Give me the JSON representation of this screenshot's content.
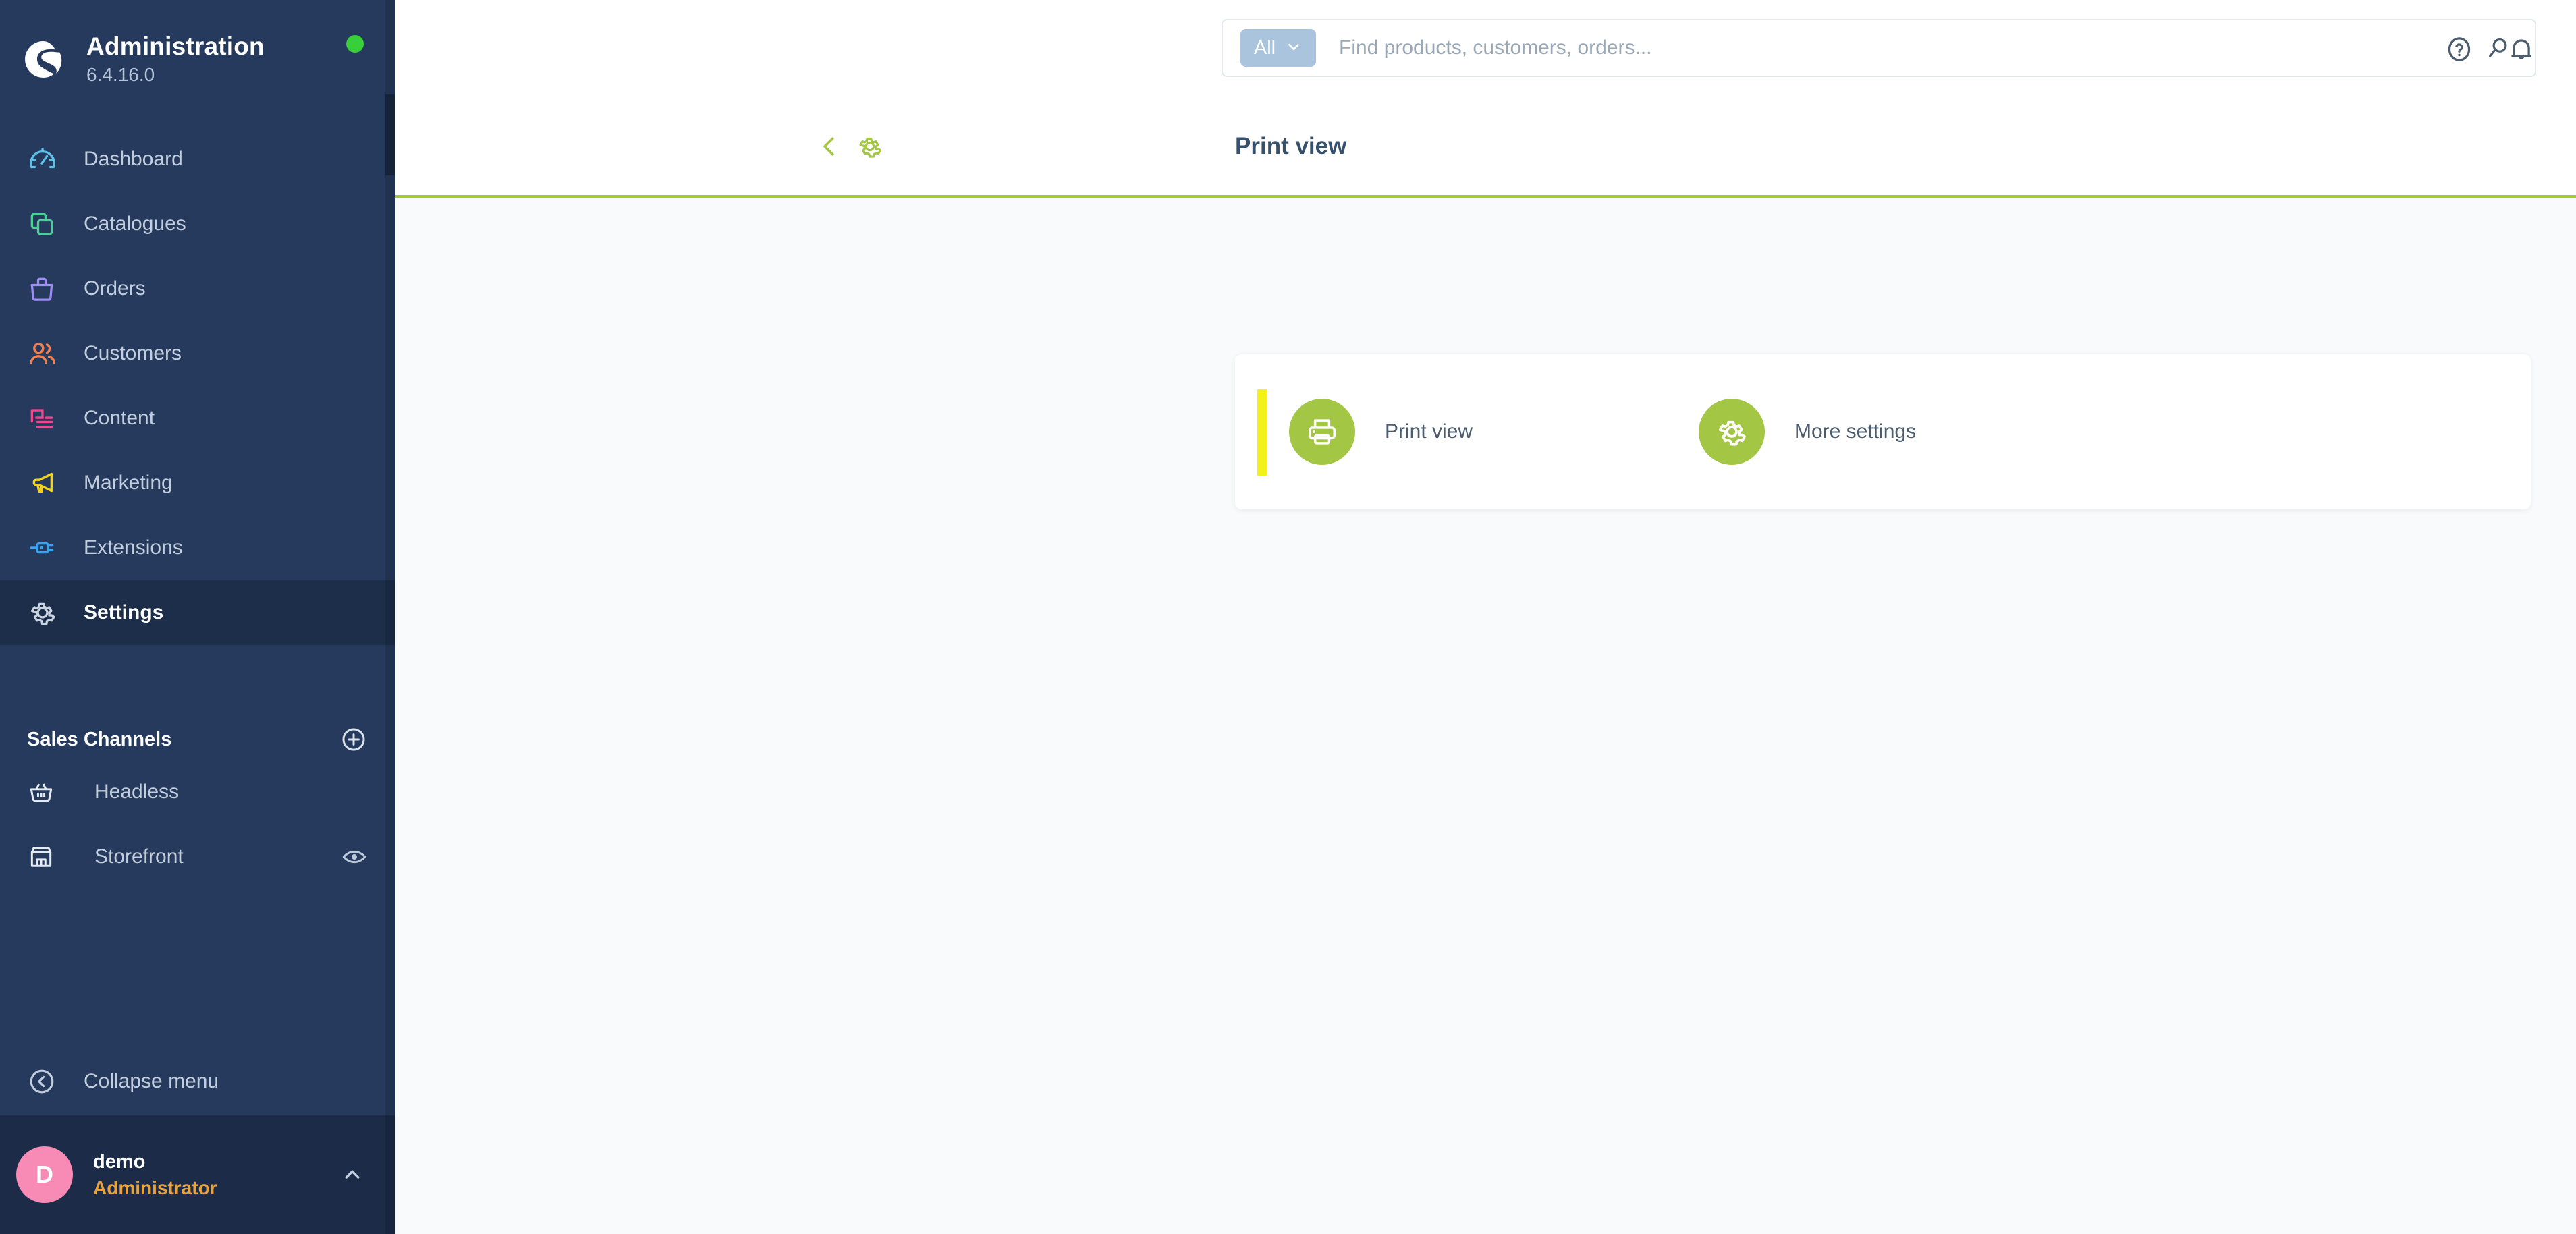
{
  "sidebar": {
    "brand": {
      "title": "Administration",
      "version": "6.4.16.0",
      "status_dot_color": "#37d03b",
      "logo_icon": "shopware-logo-icon"
    },
    "nav_items": [
      {
        "label": "Dashboard",
        "icon": "speedometer-icon",
        "color": "#5ec2e8",
        "active": false
      },
      {
        "label": "Catalogues",
        "icon": "layers-icon",
        "color": "#4ecf9a",
        "active": false
      },
      {
        "label": "Orders",
        "icon": "bag-icon",
        "color": "#9d8cf2",
        "active": false
      },
      {
        "label": "Customers",
        "icon": "users-icon",
        "color": "#ef8153",
        "active": false
      },
      {
        "label": "Content",
        "icon": "content-icon",
        "color": "#f0488f",
        "active": false
      },
      {
        "label": "Marketing",
        "icon": "megaphone-icon",
        "color": "#f2d11f",
        "active": false
      },
      {
        "label": "Extensions",
        "icon": "plug-icon",
        "color": "#3ba3f0",
        "active": false
      },
      {
        "label": "Settings",
        "icon": "gear-icon",
        "color": "#c9d3e0",
        "active": true
      }
    ],
    "sales_channels": {
      "heading": "Sales Channels",
      "add_icon": "plus-circle-icon",
      "items": [
        {
          "label": "Headless",
          "icon": "basket-icon",
          "trailing_icon": ""
        },
        {
          "label": "Storefront",
          "icon": "store-icon",
          "trailing_icon": "eye-icon"
        }
      ]
    },
    "collapse": {
      "label": "Collapse menu",
      "icon": "chevron-left-circle-icon"
    },
    "user": {
      "initial": "D",
      "name": "demo",
      "role": "Administrator",
      "avatar_color": "#f78bb6",
      "role_color": "#e8a33d",
      "caret_icon": "chevron-up-icon"
    }
  },
  "topbar": {
    "search": {
      "scope_label": "All",
      "scope_caret_icon": "chevron-down-icon",
      "placeholder": "Find products, customers, orders...",
      "value": "",
      "submit_icon": "search-icon"
    },
    "actions": [
      {
        "name": "help-icon",
        "icon": "question-circle-icon"
      },
      {
        "name": "notifications-icon",
        "icon": "bell-icon"
      }
    ]
  },
  "smartbar": {
    "back_icon": "chevron-left-icon",
    "gear_icon": "gear-icon",
    "heading": "Print view",
    "accent_color": "#a3c644"
  },
  "content": {
    "card": {
      "accent_color": "#f4f118",
      "actions": [
        {
          "label": "Print view",
          "icon": "printer-icon",
          "circle_color": "#a3c644"
        },
        {
          "label": "More settings",
          "icon": "gear-icon",
          "circle_color": "#a3c644"
        }
      ]
    }
  }
}
